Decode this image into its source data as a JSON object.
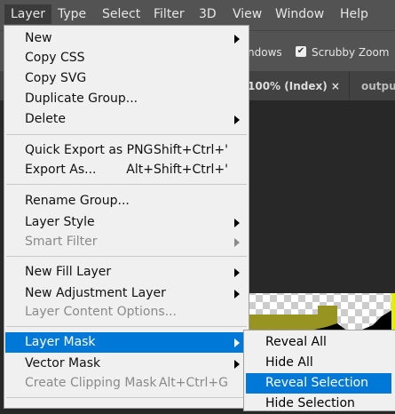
{
  "menubar": {
    "items": [
      "Layer",
      "Type",
      "Select",
      "Filter",
      "3D",
      "View",
      "Window",
      "Help"
    ]
  },
  "options_bar": {
    "windows_label": "ndows",
    "scrubby_zoom": "Scrubby Zoom",
    "scrubby_checked": true
  },
  "tabs": [
    {
      "label": "100% (Index)",
      "close": "×"
    },
    {
      "label": "outpu"
    }
  ],
  "layer_menu": [
    {
      "label": "New",
      "submenu": true
    },
    {
      "label": "Copy CSS"
    },
    {
      "label": "Copy SVG"
    },
    {
      "label": "Duplicate Group..."
    },
    {
      "label": "Delete",
      "submenu": true
    },
    {
      "label": "Quick Export as PNG",
      "shortcut": "Shift+Ctrl+'"
    },
    {
      "label": "Export As...",
      "shortcut": "Alt+Shift+Ctrl+'"
    },
    {
      "label": "Rename Group..."
    },
    {
      "label": "Layer Style",
      "submenu": true
    },
    {
      "label": "Smart Filter",
      "submenu": true,
      "disabled": true
    },
    {
      "label": "New Fill Layer",
      "submenu": true
    },
    {
      "label": "New Adjustment Layer",
      "submenu": true
    },
    {
      "label": "Layer Content Options...",
      "disabled": true
    },
    {
      "label": "Layer Mask",
      "submenu": true,
      "highlighted": true
    },
    {
      "label": "Vector Mask",
      "submenu": true
    },
    {
      "label": "Create Clipping Mask",
      "shortcut": "Alt+Ctrl+G",
      "disabled": true
    }
  ],
  "layer_mask_submenu": [
    {
      "label": "Reveal All"
    },
    {
      "label": "Hide All"
    },
    {
      "label": "Reveal Selection",
      "highlighted": true
    },
    {
      "label": "Hide Selection"
    }
  ],
  "colors": {
    "highlight": "#0078d7",
    "olive": "#979421"
  }
}
